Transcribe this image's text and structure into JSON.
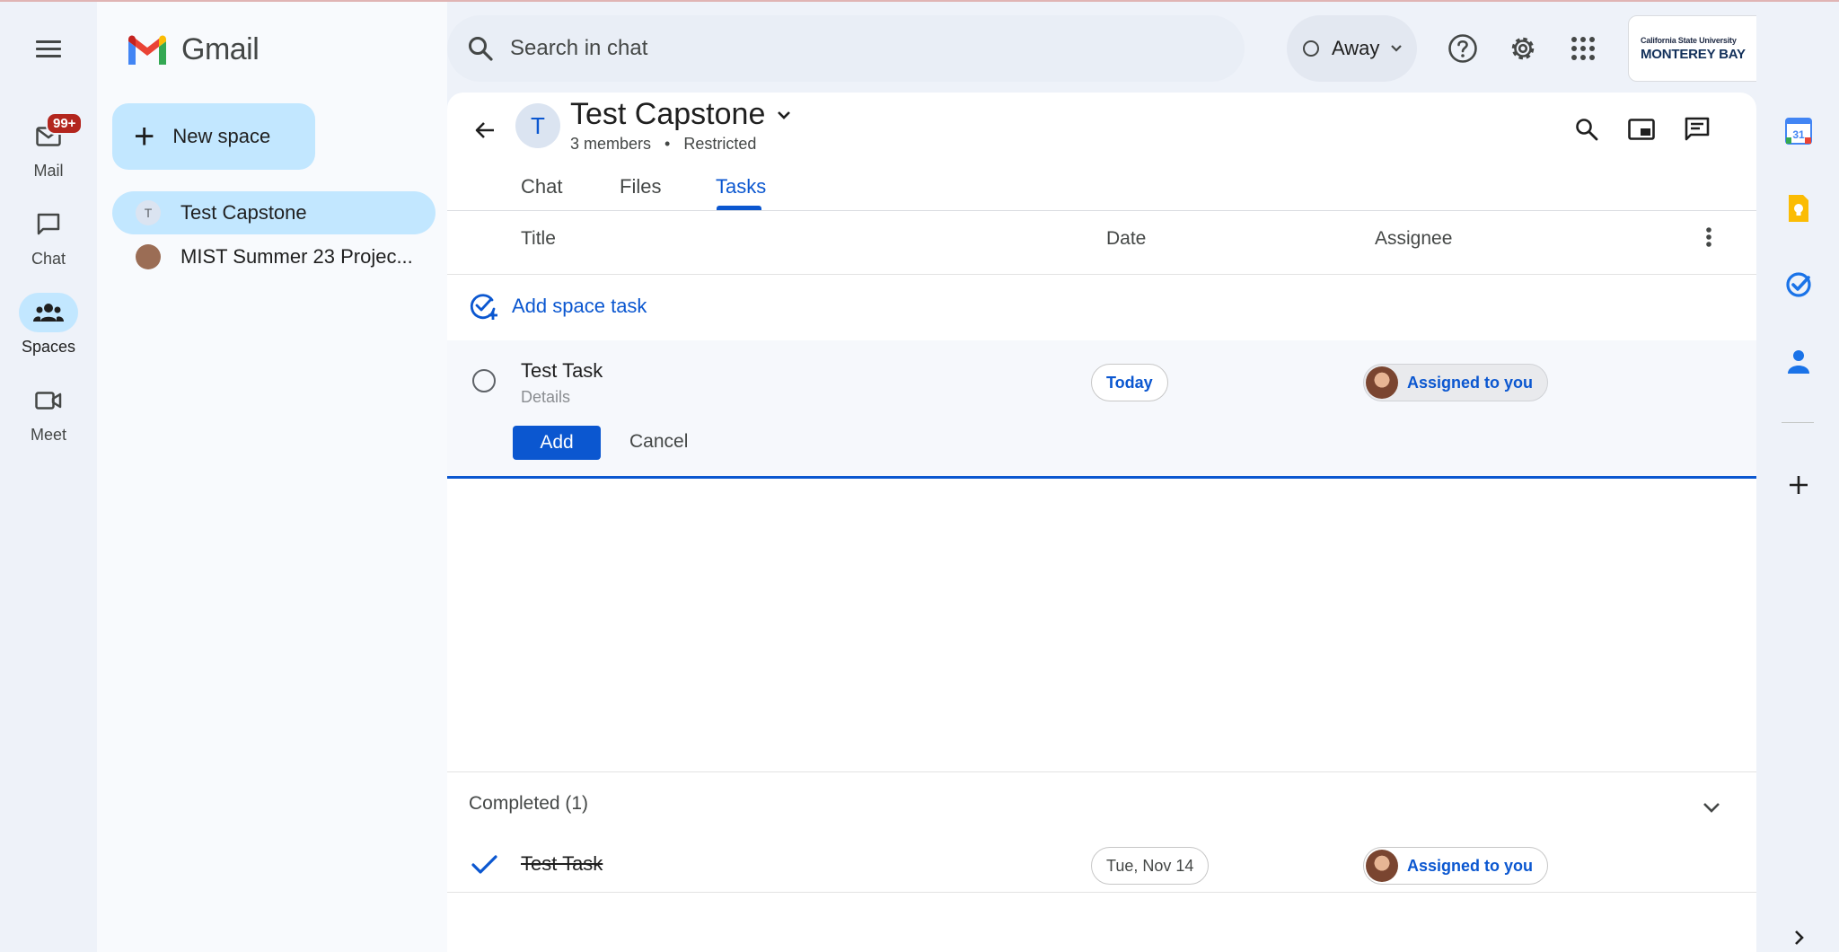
{
  "app": {
    "name": "Gmail"
  },
  "rail": {
    "items": [
      {
        "label": "Mail",
        "badge": "99+"
      },
      {
        "label": "Chat"
      },
      {
        "label": "Spaces"
      },
      {
        "label": "Meet"
      }
    ]
  },
  "sidebar": {
    "new_space_label": "New space",
    "spaces": [
      {
        "name": "Test Capstone",
        "initial": "T"
      },
      {
        "name": "MIST Summer 23 Projec..."
      }
    ]
  },
  "search": {
    "placeholder": "Search in chat"
  },
  "status": {
    "label": "Away"
  },
  "account": {
    "org_line1": "California State University",
    "org_line2": "MONTEREY BAY"
  },
  "space": {
    "initial": "T",
    "title": "Test Capstone",
    "members": "3 members",
    "separator": "•",
    "access": "Restricted"
  },
  "tabs": [
    {
      "label": "Chat"
    },
    {
      "label": "Files"
    },
    {
      "label": "Tasks"
    }
  ],
  "active_tab": "Tasks",
  "columns": {
    "title": "Title",
    "date": "Date",
    "assignee": "Assignee"
  },
  "add_task_label": "Add space task",
  "editing_task": {
    "title": "Test Task",
    "details_placeholder": "Details",
    "date": "Today",
    "assignee": "Assigned to you",
    "add_label": "Add",
    "cancel_label": "Cancel"
  },
  "completed": {
    "header": "Completed (1)",
    "tasks": [
      {
        "title": "Test Task",
        "date": "Tue, Nov 14",
        "assignee": "Assigned to you"
      }
    ]
  },
  "side_panel": {
    "calendar_day": "31"
  },
  "colors": {
    "accent": "#0b57d0",
    "active_bg": "#c2e7ff",
    "badge": "#b3261e"
  }
}
